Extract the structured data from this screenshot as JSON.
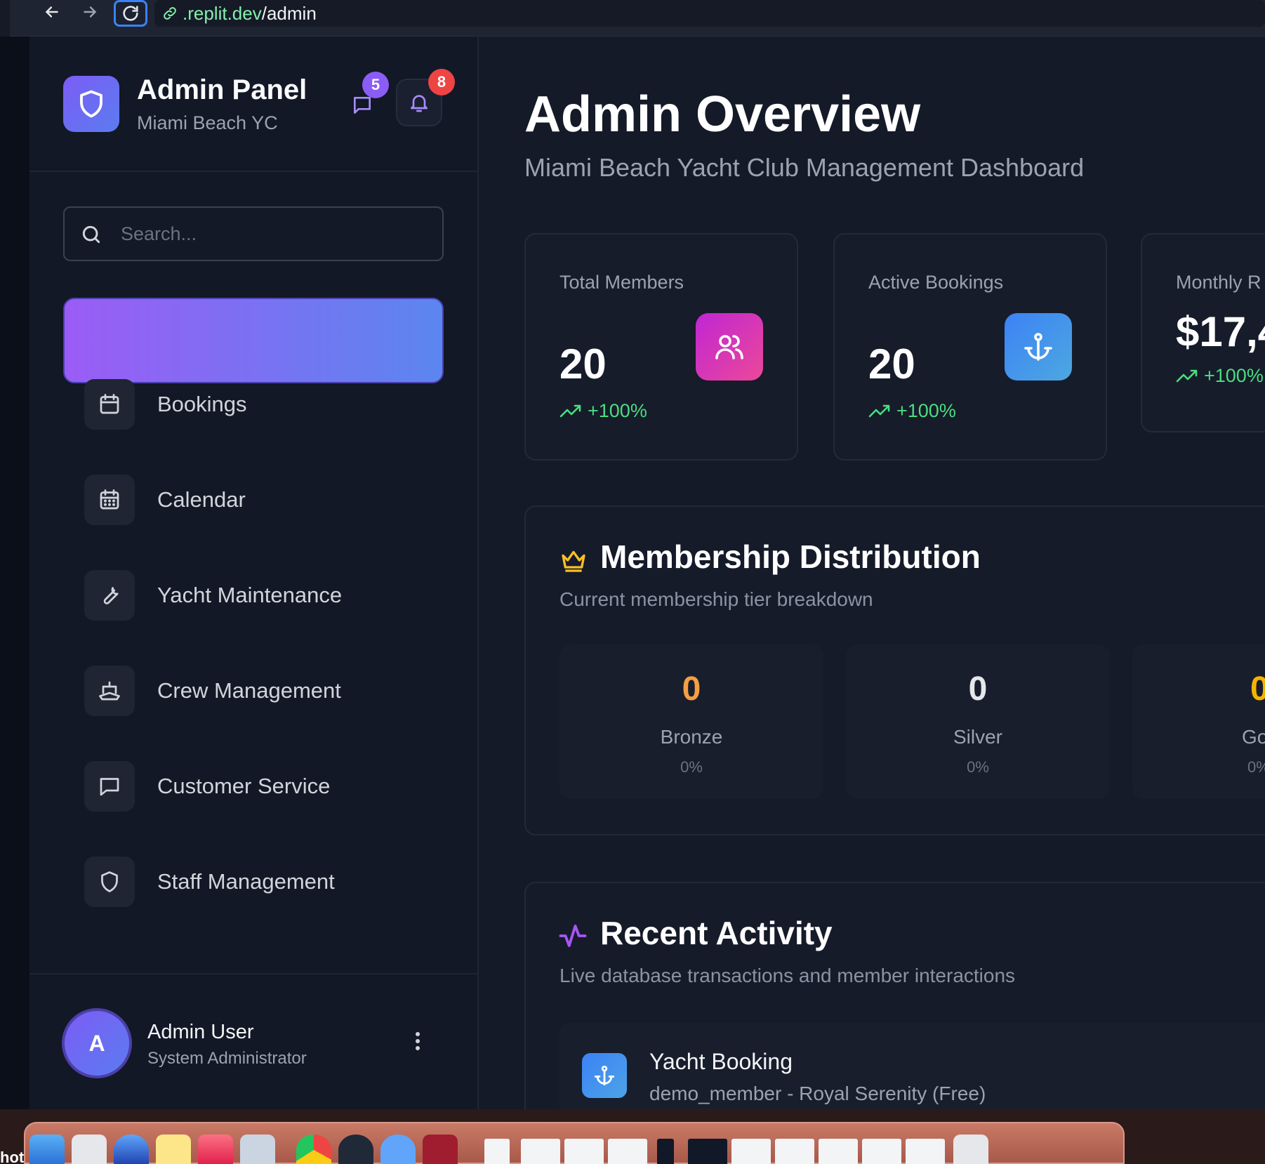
{
  "browser": {
    "url_host": ".replit.dev",
    "url_path": "/admin"
  },
  "sidebar": {
    "brand_title": "Admin Panel",
    "brand_subtitle": "Miami Beach YC",
    "messages_badge": "5",
    "notifications_badge": "8",
    "search_placeholder": "Search...",
    "items": [
      {
        "label": "Bookings",
        "icon": "calendar-icon"
      },
      {
        "label": "Calendar",
        "icon": "calendar-days-icon"
      },
      {
        "label": "Yacht Maintenance",
        "icon": "wrench-icon"
      },
      {
        "label": "Crew Management",
        "icon": "ship-icon"
      },
      {
        "label": "Customer Service",
        "icon": "message-icon"
      },
      {
        "label": "Staff Management",
        "icon": "shield-icon"
      }
    ],
    "user": {
      "initial": "A",
      "name": "Admin User",
      "role": "System Administrator"
    }
  },
  "main": {
    "title": "Admin Overview",
    "subtitle": "Miami Beach Yacht Club Management Dashboard",
    "stats": [
      {
        "label": "Total Members",
        "value": "20",
        "trend": "+100%",
        "icon": "users-icon",
        "color": "#d946ef"
      },
      {
        "label": "Active Bookings",
        "value": "20",
        "trend": "+100%",
        "icon": "anchor-icon",
        "color": "#3b82f6"
      },
      {
        "label": "Monthly R",
        "value": "$17,4",
        "trend": "+100%"
      }
    ],
    "membership": {
      "title": "Membership Distribution",
      "subtitle": "Current membership tier breakdown",
      "tiers": [
        {
          "count": "0",
          "name": "Bronze",
          "pct": "0%",
          "color": "#f59e42"
        },
        {
          "count": "0",
          "name": "Silver",
          "pct": "0%",
          "color": "#e5e7eb"
        },
        {
          "count": "0",
          "name": "Go",
          "pct": "0%",
          "color": "#f5b400"
        }
      ]
    },
    "activity": {
      "title": "Recent Activity",
      "subtitle": "Live database transactions and member interactions",
      "items": [
        {
          "title": "Yacht Booking",
          "desc": "demo_member - Royal Serenity (Free)",
          "icon": "anchor-icon"
        }
      ]
    }
  },
  "dock": {
    "partial_label": "hot"
  },
  "colors": {
    "accent_purple": "#8b5cf6",
    "accent_blue": "#3b82f6",
    "trend_green": "#4ade80",
    "crown_gold": "#fbbf24",
    "badge_red": "#ef4444"
  }
}
